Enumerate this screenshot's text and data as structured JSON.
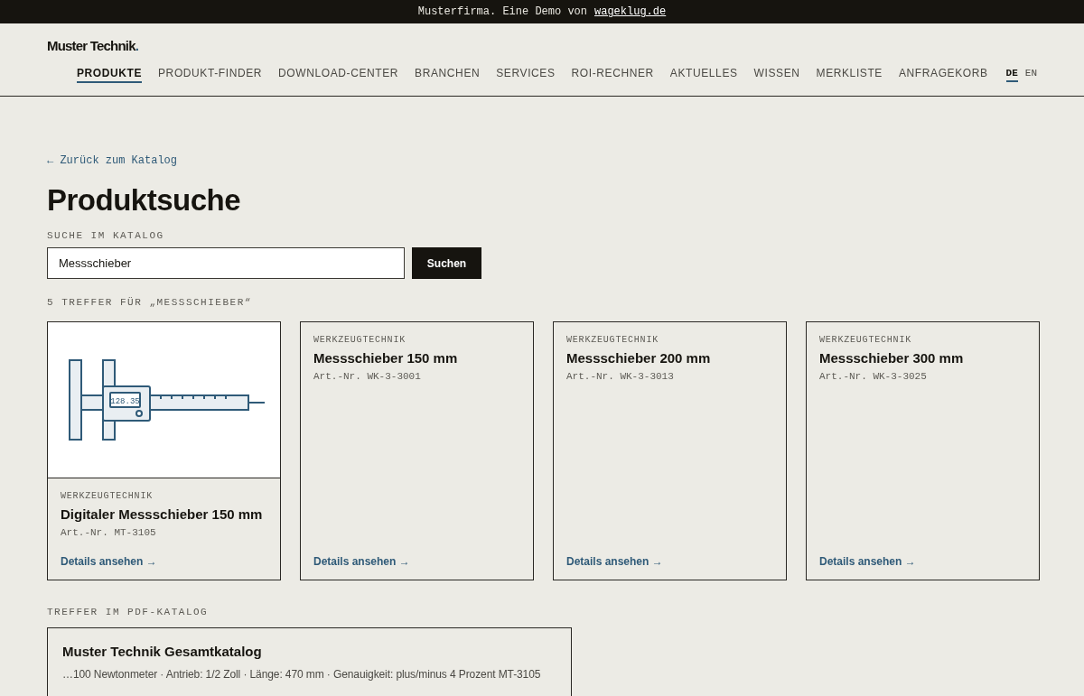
{
  "banner": {
    "text": "Musterfirma. Eine Demo von",
    "link": "wageklug.de"
  },
  "logo": {
    "name": "Muster Technik",
    "mark": "."
  },
  "nav": [
    {
      "label": "PRODUKTE",
      "selected": true
    },
    {
      "label": "PRODUKT-FINDER",
      "selected": false
    },
    {
      "label": "DOWNLOAD-CENTER",
      "selected": false
    },
    {
      "label": "BRANCHEN",
      "selected": false
    },
    {
      "label": "SERVICES",
      "selected": false
    },
    {
      "label": "ROI-RECHNER",
      "selected": false
    },
    {
      "label": "AKTUELLES",
      "selected": false
    },
    {
      "label": "WISSEN",
      "selected": false
    },
    {
      "label": "MERKLISTE",
      "selected": false
    },
    {
      "label": "ANFRAGEKORB",
      "selected": false
    }
  ],
  "languages": [
    {
      "label": "DE",
      "selected": true
    },
    {
      "label": "EN",
      "selected": false
    }
  ],
  "back_link": "← Zurück zum Katalog",
  "title": "Produktsuche",
  "search": {
    "label": "SUCHE IM KATALOG",
    "value": "Messschieber",
    "button": "Suchen"
  },
  "results_label": "5 TREFFER FÜR „MESSSCHIEBER“",
  "products": [
    {
      "kind": "illustrated",
      "display": "128.35",
      "category": "WERKZEUGTECHNIK",
      "name": "Digitaler Messschieber 150 mm",
      "article": "Art.-Nr. MT-3105",
      "link": "Details ansehen →"
    },
    {
      "kind": "plain",
      "category": "WERKZEUGTECHNIK",
      "name": "Messschieber 150 mm",
      "article": "Art.-Nr. WK-3-3001",
      "link": "Details ansehen →"
    },
    {
      "kind": "plain",
      "category": "WERKZEUGTECHNIK",
      "name": "Messschieber 200 mm",
      "article": "Art.-Nr. WK-3-3013",
      "link": "Details ansehen →"
    },
    {
      "kind": "plain",
      "category": "WERKZEUGTECHNIK",
      "name": "Messschieber 300 mm",
      "article": "Art.-Nr. WK-3-3025",
      "link": "Details ansehen →"
    }
  ],
  "pdf": {
    "label": "TREFFER IM PDF-KATALOG",
    "title": "Muster Technik Gesamtkatalog",
    "snippet": "…100 Newtonmeter · Antrieb: 1/2 Zoll · Länge: 470 mm · Genauigkeit: plus/minus 4 Prozent MT-3105"
  }
}
